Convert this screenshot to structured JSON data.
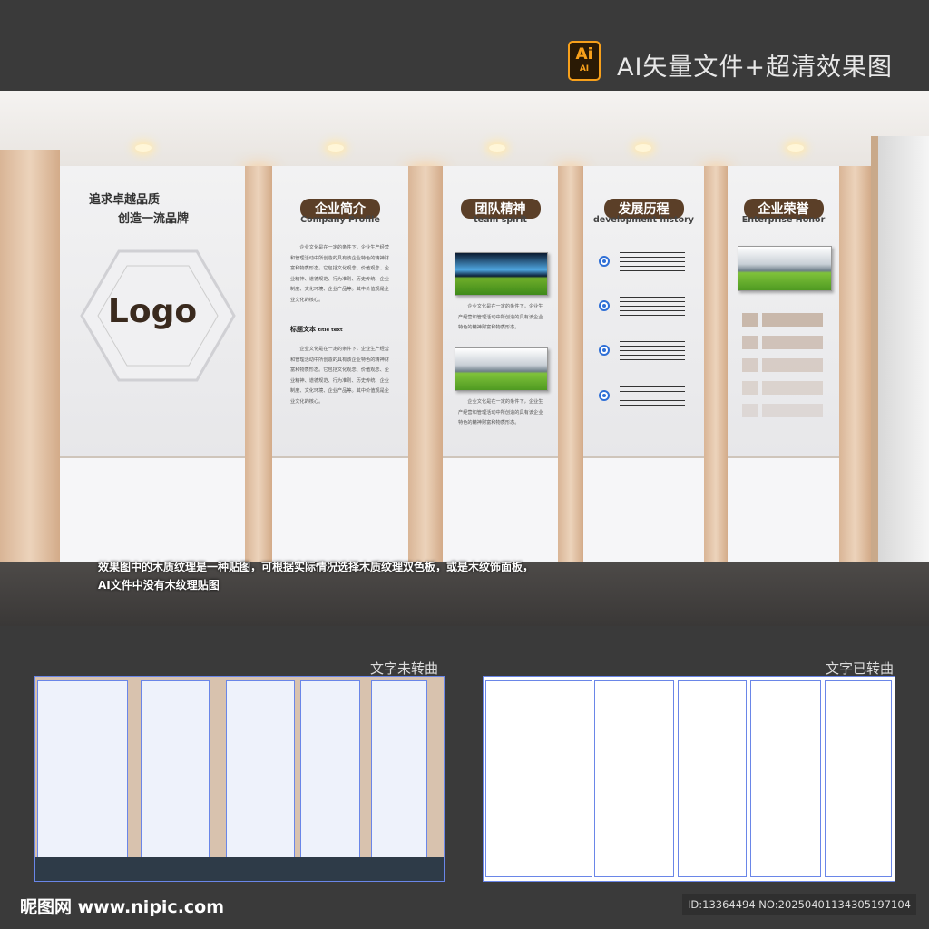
{
  "header": {
    "badge": "Ai",
    "badge_sub": "AI",
    "label": "AI矢量文件+超清效果图"
  },
  "wall": {
    "slogan_1": "追求卓越品质",
    "slogan_2": "创造一流品牌",
    "logo": "Logo",
    "panels": [
      {
        "title": "企业简介",
        "subtitle": "Company Profile",
        "heading": "标题文本",
        "heading_en": "title text"
      },
      {
        "title": "团队精神",
        "subtitle": "team spirit"
      },
      {
        "title": "发展历程",
        "subtitle": "development history"
      },
      {
        "title": "企业荣誉",
        "subtitle": "Enterprise Honor"
      }
    ],
    "body_text": "企业文化是在一定的条件下，企业生产经营和管理活动中所创造的具有该企业特色的精神财富和物质形态。它包括文化观念、价值观念、企业精神、道德规范、行为准则、历史传统、企业制度、文化环境、企业产品等。其中价值观是企业文化的核心。",
    "body_text_short": "企业文化是在一定的条件下，企业生产经营和管理活动中所创造的具有该企业特色的精神财富和物质形态。"
  },
  "caption": {
    "line1": "效果图中的木质纹理是一种贴图，可根据实际情况选择木质纹理双色板，或是木纹饰面板，",
    "line2": "AI文件中没有木纹理贴图"
  },
  "previews": {
    "left_label": "文字未转曲",
    "right_label": "文字已转曲"
  },
  "footer": {
    "brand": "昵图网 www.nipic.com",
    "id_text": "ID:13364494 NO:20250401134305197104"
  },
  "colors": {
    "accent_brown": "#5b3f28",
    "timeline_blue": "#2f6fd6",
    "ai_orange": "#f7a01b"
  }
}
